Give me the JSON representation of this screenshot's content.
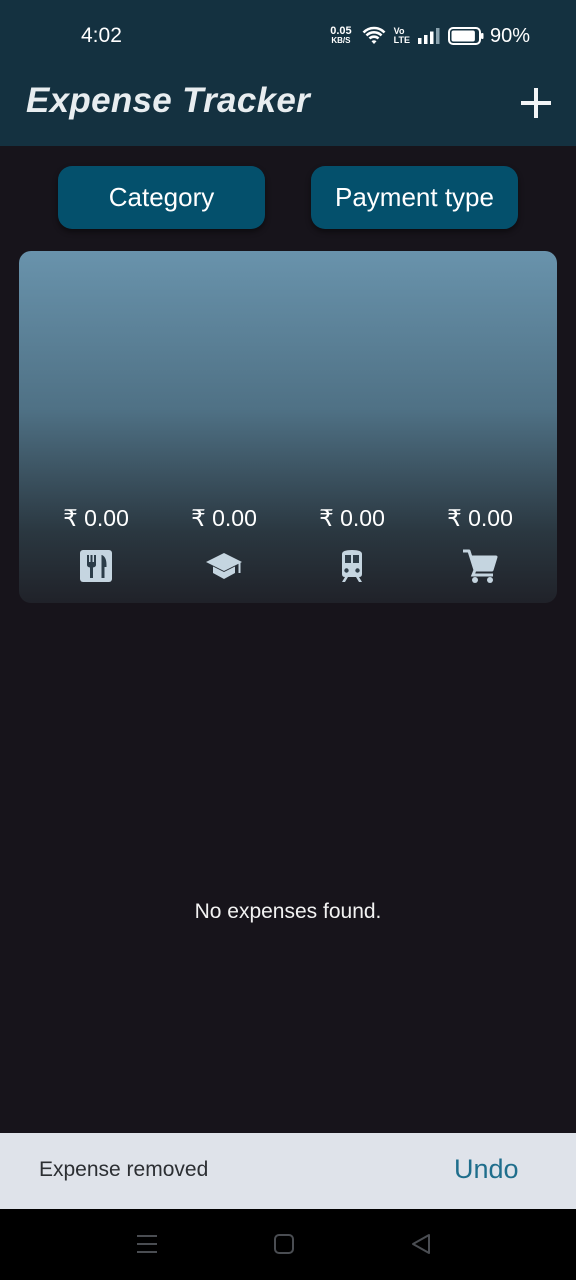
{
  "status_bar": {
    "time": "4:02",
    "net_speed_value": "0.05",
    "net_speed_unit": "KB/S",
    "volte_top": "Vo",
    "volte_bottom": "LTE",
    "battery_percent": "90%",
    "battery_level": 0.9
  },
  "app_bar": {
    "title": "Expense Tracker",
    "add_icon": "plus-icon"
  },
  "filters": {
    "category_label": "Category",
    "payment_type_label": "Payment type",
    "button_color": "#04506c"
  },
  "summary": {
    "buckets": [
      {
        "amount": "₹ 0.00",
        "icon": "restaurant-icon"
      },
      {
        "amount": "₹ 0.00",
        "icon": "school-icon"
      },
      {
        "amount": "₹ 0.00",
        "icon": "train-icon"
      },
      {
        "amount": "₹ 0.00",
        "icon": "shopping-cart-icon"
      }
    ]
  },
  "empty_state": {
    "message": "No expenses found."
  },
  "snackbar": {
    "message": "Expense removed",
    "action_label": "Undo",
    "action_color": "#1f6e8c"
  },
  "colors": {
    "app_bar": "#143140",
    "background": "#17141b",
    "snackbar": "#dfe3ea"
  }
}
